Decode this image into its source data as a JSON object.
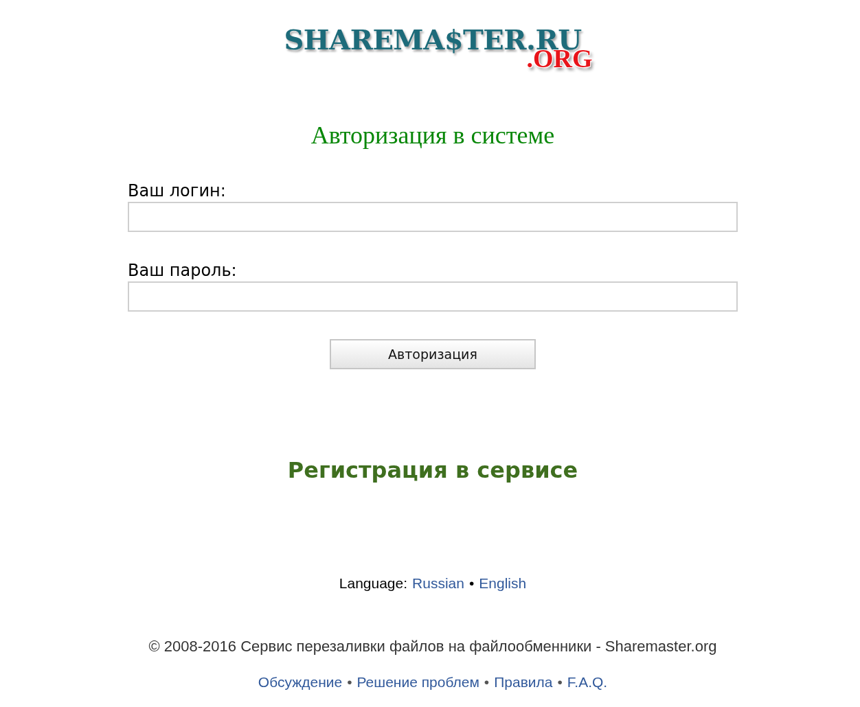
{
  "logo": {
    "text": "SHAREMA$TER.RU",
    "suffix": ".ORG"
  },
  "heading": "Авторизация в системе",
  "fields": [
    {
      "label": "Ваш логин:"
    },
    {
      "label": "Ваш пароль:"
    }
  ],
  "submit_button": "Авторизация",
  "registration_link": "Регистрация в сервисе",
  "language": {
    "label": "Language:",
    "items": [
      {
        "kind": "link",
        "text": "Russian"
      },
      {
        "kind": "separator",
        "text": "•"
      },
      {
        "kind": "link",
        "text": "English"
      }
    ]
  },
  "copyright": "© 2008-2016 Сервис перезаливки файлов на файлообменники - Sharemaster.org",
  "footer_links": [
    {
      "kind": "link",
      "text": "Обсуждение"
    },
    {
      "kind": "separator",
      "text": "•"
    },
    {
      "kind": "link",
      "text": "Решение проблем"
    },
    {
      "kind": "separator",
      "text": "•"
    },
    {
      "kind": "link",
      "text": "Правила"
    },
    {
      "kind": "separator",
      "text": "•"
    },
    {
      "kind": "link",
      "text": "F.A.Q."
    }
  ]
}
